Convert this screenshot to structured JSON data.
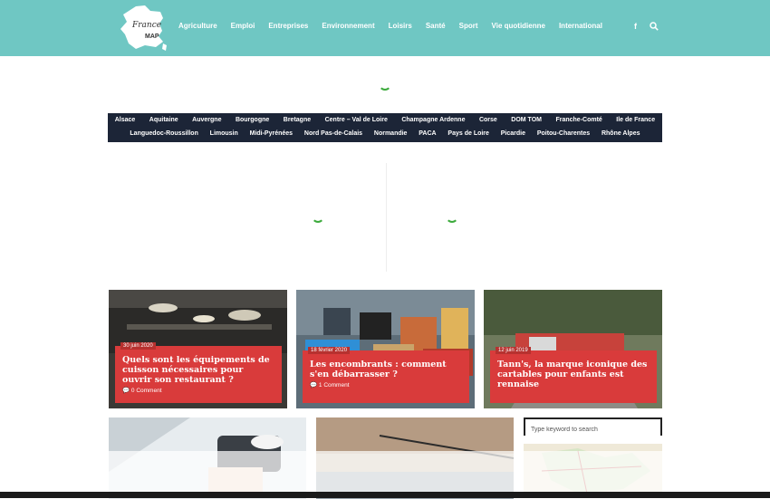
{
  "header": {
    "logo_text": "France",
    "logo_sub": "MAP",
    "nav": [
      "Agriculture",
      "Emploi",
      "Entreprises",
      "Environnement",
      "Loisirs",
      "Santé",
      "Sport",
      "Vie quotidienne",
      "International"
    ],
    "facebook_glyph": "f",
    "search_glyph": "⚲",
    "bg_color": "#6fc7c3"
  },
  "regions": {
    "row1": [
      "Alsace",
      "Aquitaine",
      "Auvergne",
      "Bourgogne",
      "Bretagne",
      "Centre – Val de Loire",
      "Champagne Ardenne",
      "Corse",
      "DOM TOM",
      "Franche-Comté",
      "Ile de France"
    ],
    "row2": [
      "Languedoc-Roussillon",
      "Limousin",
      "Midi-Pyrénées",
      "Nord Pas-de-Calais",
      "Normandie",
      "PACA",
      "Pays de Loire",
      "Picardie",
      "Poitou-Charentes",
      "Rhône Alpes"
    ],
    "bg_color": "#1c2537"
  },
  "cards": [
    {
      "date": "30 juin 2020",
      "title": "Quels sont les équipements de cuisson nécessaires pour ouvrir son restaurant ?",
      "comment": "0 Comment"
    },
    {
      "date": "18 février 2020",
      "title": "Les encombrants : comment s'en débarrasser ?",
      "comment": "1 Comment"
    },
    {
      "date": "12 juin 2019",
      "title": "Tann's, la marque iconique des cartables pour enfants est rennaise",
      "comment": ""
    }
  ],
  "search": {
    "placeholder": "Type keyword to search"
  },
  "accent_color": "#d93b3b"
}
